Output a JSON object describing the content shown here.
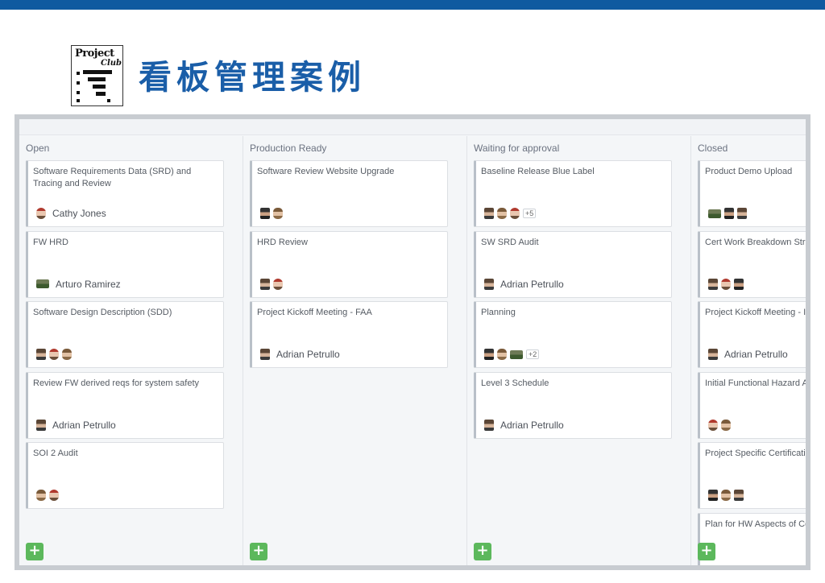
{
  "header": {
    "title": "看板管理案例",
    "logo": {
      "line1": "Project",
      "line2": "Club"
    }
  },
  "board": {
    "columns": [
      {
        "title": "Open",
        "add_label": "+",
        "cards": [
          {
            "title": "Software Requirements Data (SRD) and Tracing and Review",
            "avatars": [
              "a5"
            ],
            "person": "Cathy Jones"
          },
          {
            "title": "FW HRD",
            "avatars": [
              "a4"
            ],
            "person": "Arturo Ramirez"
          },
          {
            "title": "Software Design Description (SDD)",
            "avatars": [
              "a1",
              "a5",
              "a2"
            ],
            "person": ""
          },
          {
            "title": "Review FW derived reqs for system safety",
            "avatars": [
              "a1"
            ],
            "person": "Adrian Petrullo"
          },
          {
            "title": "SOI 2 Audit",
            "avatars": [
              "a2",
              "a5"
            ],
            "person": ""
          }
        ]
      },
      {
        "title": "Production Ready",
        "add_label": "+",
        "cards": [
          {
            "title": "Software Review Website Upgrade",
            "avatars": [
              "a3",
              "a2"
            ],
            "person": ""
          },
          {
            "title": "HRD Review",
            "avatars": [
              "a1",
              "a5"
            ],
            "person": ""
          },
          {
            "title": "Project Kickoff Meeting - FAA",
            "avatars": [
              "a1"
            ],
            "person": "Adrian Petrullo"
          }
        ]
      },
      {
        "title": "Waiting for approval",
        "add_label": "+",
        "cards": [
          {
            "title": "Baseline Release Blue Label",
            "avatars": [
              "a1",
              "a2",
              "a5"
            ],
            "more": "+5",
            "person": ""
          },
          {
            "title": "SW SRD Audit",
            "avatars": [
              "a1"
            ],
            "person": "Adrian Petrullo"
          },
          {
            "title": "Planning",
            "avatars": [
              "a3",
              "a2",
              "a4"
            ],
            "more": "+2",
            "person": ""
          },
          {
            "title": "Level 3 Schedule",
            "avatars": [
              "a1"
            ],
            "person": "Adrian Petrullo"
          }
        ]
      },
      {
        "title": "Closed",
        "add_label": "+",
        "cards": [
          {
            "title": "Product Demo Upload",
            "avatars": [
              "a4",
              "a3",
              "a1"
            ],
            "person": ""
          },
          {
            "title": "Cert Work Breakdown Stru",
            "avatars": [
              "a1",
              "a5",
              "a3"
            ],
            "person": ""
          },
          {
            "title": "Project Kickoff Meeting - Ir",
            "avatars": [
              "a1"
            ],
            "person": "Adrian Petrullo"
          },
          {
            "title": "Initial Functional Hazard A",
            "avatars": [
              "a5",
              "a2"
            ],
            "person": ""
          },
          {
            "title": "Project Specific Certificatio",
            "avatars": [
              "a3",
              "a2",
              "a1"
            ],
            "person": ""
          },
          {
            "title": "Plan for HW Aspects of Cer",
            "avatars": [],
            "person": ""
          }
        ]
      }
    ]
  }
}
